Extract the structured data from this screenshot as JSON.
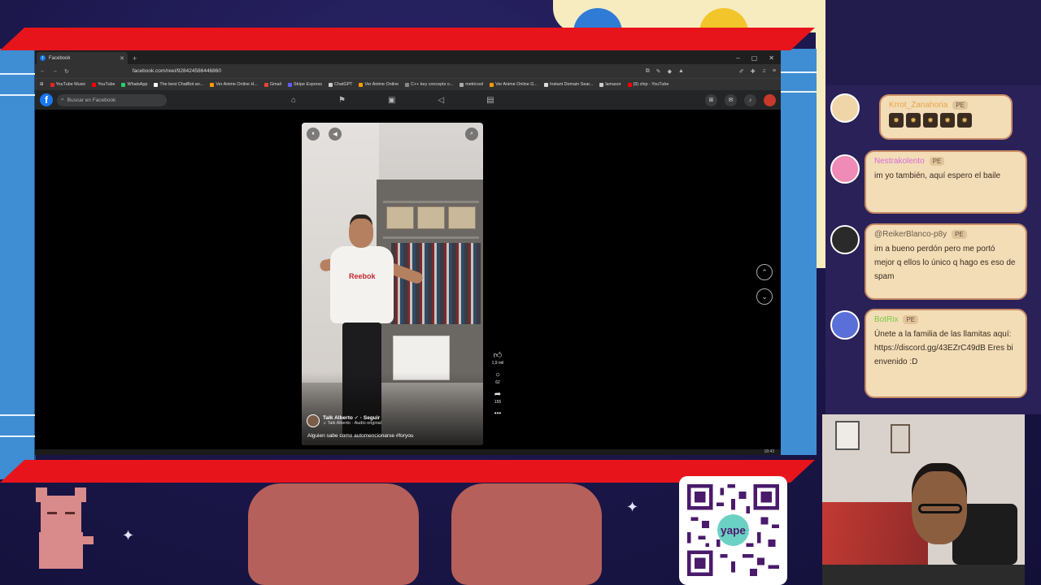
{
  "browser": {
    "tab_title": "Facebook",
    "tab_icon": "f",
    "new_tab": "+",
    "url": "facebook.com/reel/928424586446860",
    "bookmarks": [
      "YouTube Music",
      "YouTube",
      "WhatsApp",
      "The best ChatBot an...",
      "Ver Anime Online H...",
      "Gmail",
      "Stripe Express",
      "ChatGPT",
      "Ver Anime Online",
      "C++ key concepts o...",
      "metricool",
      "Ver Anime Online G...",
      "Instant Domain Sear...",
      "lamasor",
      "(9) chip - YouTube"
    ]
  },
  "facebook": {
    "logo": "f",
    "search_placeholder": "Buscar en Facebook"
  },
  "reel": {
    "shirt_brand": "Reebok",
    "author": "Talk Alberto",
    "follow": "Seguir",
    "audio": "Talk Alberto · Audio original",
    "caption": "Alguien sabe como automencionarse #foryou",
    "likes": "1,9 mil",
    "comments": "62",
    "shares": "155",
    "more": "•••"
  },
  "taskbar": {
    "clock": "18:43"
  },
  "chat": [
    {
      "user": "Krrot_Zanahoria",
      "badge": "PE",
      "text": "",
      "emotes": 5,
      "color": "#e8a24a",
      "avatar_color": "#f0d5a8"
    },
    {
      "user": "Nestrakolento",
      "badge": "PE",
      "text": "im yo también, aquí espero el baile",
      "color": "#d86bd8",
      "avatar_color": "#f08ab6"
    },
    {
      "user": "@ReikerBlanco-p8y",
      "badge": "PE",
      "text": "im a bueno perdón pero me portó mejor q ellos lo único q hago es eso de spam",
      "color": "#6b5a4a",
      "avatar_color": "#2a2a2a"
    },
    {
      "user": "BotRix",
      "badge": "PE",
      "text": "Únete a la familia de las llamitas aquí: https://discord.gg/43EZrC49dB Eres bienvenido :D",
      "color": "#7ac943",
      "avatar_color": "#5b6fd8"
    }
  ],
  "qr": {
    "label": "yape"
  }
}
